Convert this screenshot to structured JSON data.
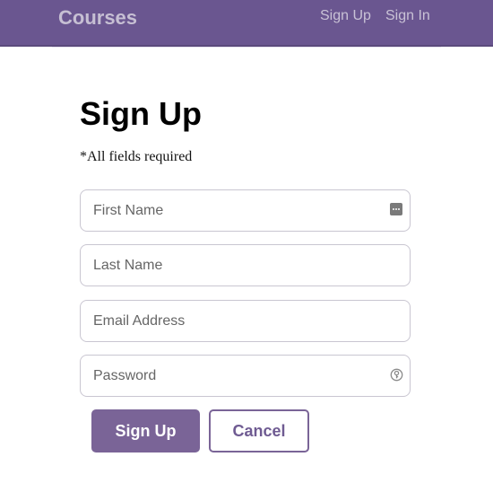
{
  "header": {
    "brand": "Courses",
    "nav": {
      "sign_up": "Sign Up",
      "sign_in": "Sign In"
    }
  },
  "form": {
    "title": "Sign Up",
    "required_note": "*All fields required",
    "fields": {
      "first_name": {
        "placeholder": "First Name",
        "value": ""
      },
      "last_name": {
        "placeholder": "Last Name",
        "value": ""
      },
      "email": {
        "placeholder": "Email Address",
        "value": ""
      },
      "password": {
        "placeholder": "Password",
        "value": ""
      }
    },
    "submit_label": "Sign Up",
    "cancel_label": "Cancel"
  },
  "icons": {
    "first_name_trailing": "autofill-contact-icon",
    "password_trailing": "password-key-icon"
  },
  "colors": {
    "header_bg": "#6a5690",
    "accent": "#7a6497",
    "header_text": "#c6bfd3"
  }
}
